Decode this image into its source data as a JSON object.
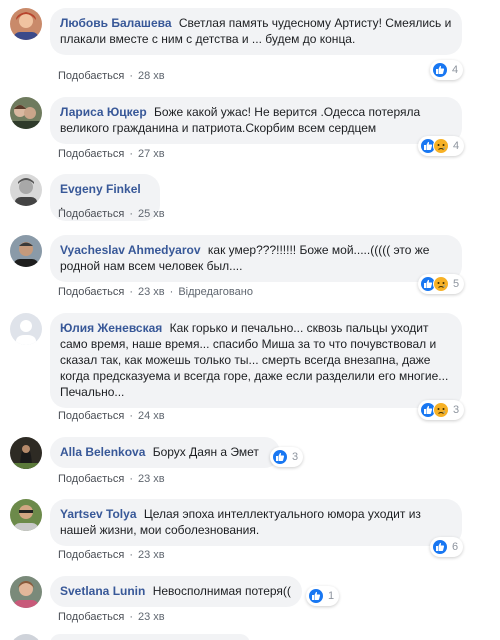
{
  "colors": {
    "author": "#385898",
    "bubble": "#f2f3f5",
    "like": "#1877f2",
    "sad": "#f7b125"
  },
  "action_like": "Подобається",
  "action_edited": "Відредаговано",
  "dot": "·",
  "comments": [
    {
      "author": "Любовь Балашева",
      "text": "Светлая память чудесному Артисту! Смеялись и плакали вместе с ним с детства и ... будем до конца.",
      "time": "28 хв",
      "reactions": [
        "like-icon"
      ],
      "count": "4"
    },
    {
      "author": "Лариса Юцкер",
      "text": "Боже какой ужас! Не верится .Одесса потеряла великого гражданина и патриота.Скорбим всем сердцем",
      "time": "27 хв",
      "reactions": [
        "like-icon",
        "sad-icon"
      ],
      "count": "4"
    },
    {
      "author": "Evgeny Finkel",
      "text": ".",
      "time": "25 хв",
      "reactions": [],
      "count": ""
    },
    {
      "author": "Vyacheslav Ahmedyarov",
      "text": "как умер???!!!!!! Боже мой.....((((( это же родной нам всем человек был....",
      "time": "23 хв",
      "edited": true,
      "reactions": [
        "like-icon",
        "sad-icon"
      ],
      "count": "5"
    },
    {
      "author": "Юлия Женевская",
      "text": "Как горько и печально... сквозь пальцы уходит само время, наше время... спасибо Миша за то что почувствовал и сказал так, как можешь только ты... смерть всегда внезапна, даже когда предсказуема и всегда горе, даже если разделили его многие... Печально...",
      "time": "24 хв",
      "reactions": [
        "like-icon",
        "sad-icon"
      ],
      "count": "3"
    },
    {
      "author": "Alla Belenkova",
      "text": "Борух Даян а Эмет",
      "time": "23 хв",
      "reactions": [
        "like-icon"
      ],
      "count": "3"
    },
    {
      "author": "Yartsev Tolya",
      "text": "Целая эпоха интеллектуального юмора уходит из нашей жизни, мои соболезнования.",
      "time": "23 хв",
      "reactions": [
        "like-icon"
      ],
      "count": "6"
    },
    {
      "author": "Svetlana Lunin",
      "text": "Невосполнимая потеря((",
      "time": "23 хв",
      "reactions": [
        "like-icon"
      ],
      "count": "1"
    }
  ]
}
